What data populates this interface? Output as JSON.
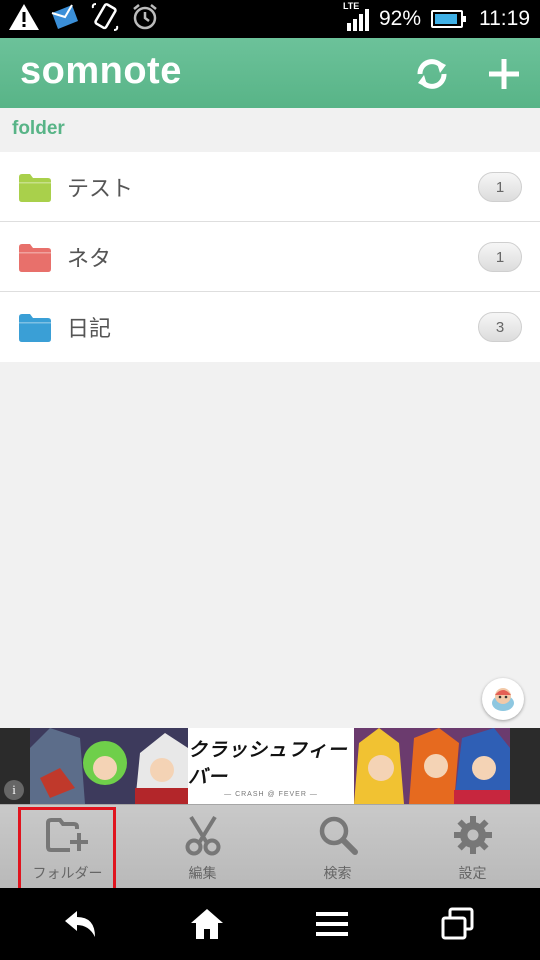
{
  "status_bar": {
    "battery_percent": "92%",
    "time": "11:19",
    "network": "LTE",
    "icons": [
      "warning-icon",
      "inbox-icon",
      "rotate-icon",
      "alarm-icon"
    ]
  },
  "header": {
    "logo": "somnote",
    "actions": [
      "sync-icon",
      "add-icon"
    ]
  },
  "section_label": "folder",
  "folders": [
    {
      "name": "テスト",
      "count": "1",
      "color": "#a9d04b"
    },
    {
      "name": "ネタ",
      "count": "1",
      "color": "#e8706b"
    },
    {
      "name": "日記",
      "count": "3",
      "color": "#3a9fd6"
    }
  ],
  "ad": {
    "title": "クラッシュフィーバー",
    "subtitle": "— CRASH @ FEVER —",
    "info": "i"
  },
  "toolbar": {
    "items": [
      {
        "label": "フォルダー",
        "icon": "add-folder-icon"
      },
      {
        "label": "編集",
        "icon": "scissors-icon"
      },
      {
        "label": "検索",
        "icon": "search-icon"
      },
      {
        "label": "設定",
        "icon": "gear-icon"
      }
    ]
  },
  "navbar": {
    "buttons": [
      "back-icon",
      "home-icon",
      "menu-icon",
      "recent-apps-icon"
    ]
  },
  "colors": {
    "brand_green": "#58b487",
    "highlight_red": "#e0141e"
  }
}
